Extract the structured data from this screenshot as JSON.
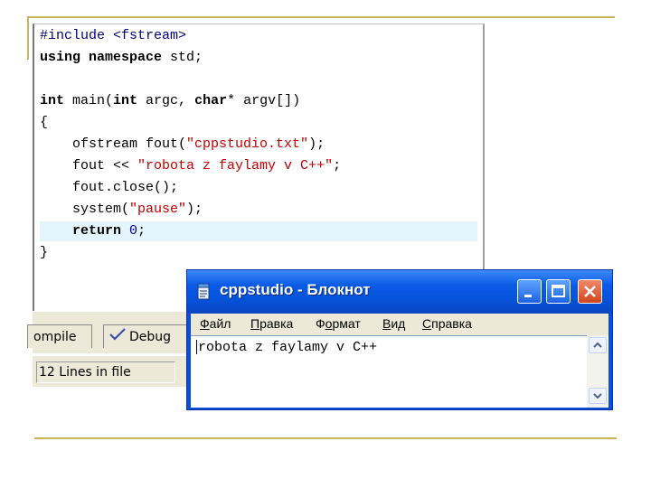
{
  "editor": {
    "lines": [
      "#include <fstream>",
      "using namespace std;",
      "",
      "int main(int argc, char* argv[])",
      "{",
      "    ofstream fout(\"cppstudio.txt\");",
      "    fout << \"robota z faylamy v C++\";",
      "    fout.close();",
      "    system(\"pause\");",
      "    return 0;",
      "}"
    ]
  },
  "ide": {
    "tabs": [
      {
        "label": "ompile Log"
      },
      {
        "label": "Debug"
      }
    ],
    "status": "12 Lines in file"
  },
  "notepad": {
    "title": "cppstudio - Блокнот",
    "menu": [
      {
        "pre": "",
        "u": "Ф",
        "post": "айл"
      },
      {
        "pre": "",
        "u": "П",
        "post": "равка"
      },
      {
        "pre": "Ф",
        "u": "о",
        "post": "рмат"
      },
      {
        "pre": "",
        "u": "В",
        "post": "ид"
      },
      {
        "pre": "",
        "u": "С",
        "post": "правка"
      }
    ],
    "content": "robota z faylamy v C++"
  },
  "colors": {
    "highlight_line": "#e3f4fb",
    "string": "#c40000",
    "xp_title_blue": "#0a5ae6",
    "slide_accent": "#c8b45a"
  }
}
